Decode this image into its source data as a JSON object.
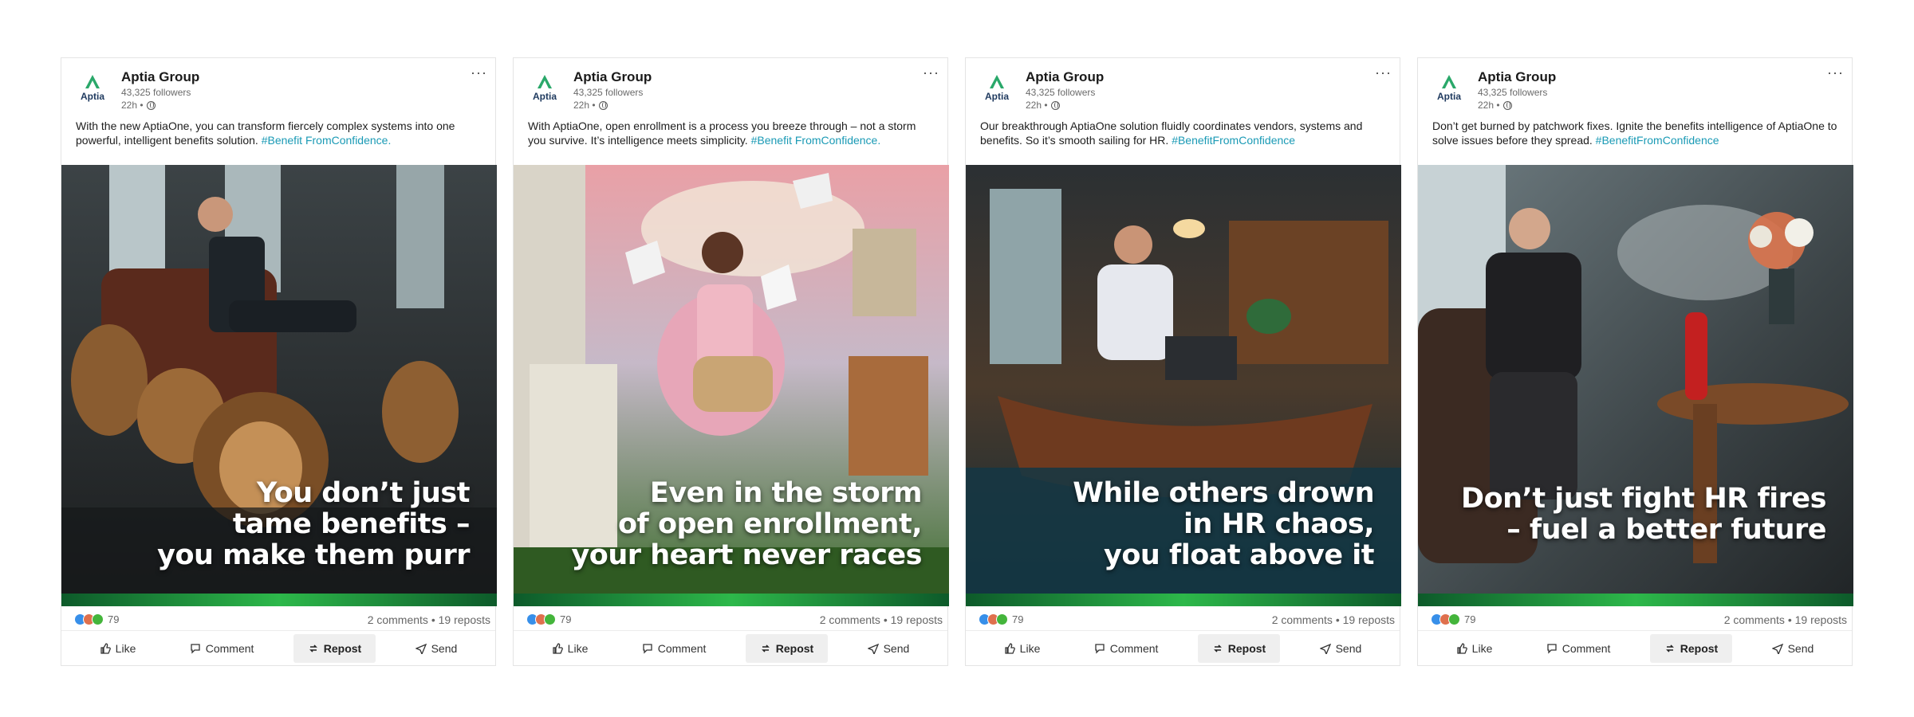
{
  "posts": [
    {
      "company": "Aptia Group",
      "logo_text": "Aptia",
      "followers": "43,325 followers",
      "time": "22h •",
      "body": "With the new AptiaOne, you can transform fiercely complex systems into one powerful, intelligent benefits solution.",
      "hashtag": "#Benefit FromConfidence.",
      "headline": [
        "You don’t just",
        "tame benefits –",
        "you make them purr"
      ],
      "reactions": "79",
      "counts": "2 comments • 19 reposts",
      "actions": [
        "Like",
        "Comment",
        "Repost",
        "Send"
      ]
    },
    {
      "company": "Aptia Group",
      "logo_text": "Aptia",
      "followers": "43,325 followers",
      "time": "22h •",
      "body": "With AptiaOne, open enrollment is a process you breeze through – not a storm you survive. It’s intelligence meets simplicity.",
      "hashtag": "#Benefit FromConfidence.",
      "headline": [
        "Even in the storm",
        "of open enrollment,",
        "your heart never races"
      ],
      "reactions": "79",
      "counts": "2 comments • 19 reposts",
      "actions": [
        "Like",
        "Comment",
        "Repost",
        "Send"
      ]
    },
    {
      "company": "Aptia Group",
      "logo_text": "Aptia",
      "followers": "43,325 followers",
      "time": "22h •",
      "body": "Our breakthrough AptiaOne solution fluidly coordinates vendors, systems and benefits. So it’s smooth sailing for HR.",
      "hashtag": "#BenefitFromConfidence",
      "headline": [
        "While others drown",
        "in HR chaos,",
        "you float above it"
      ],
      "reactions": "79",
      "counts": "2 comments • 19 reposts",
      "actions": [
        "Like",
        "Comment",
        "Repost",
        "Send"
      ]
    },
    {
      "company": "Aptia Group",
      "logo_text": "Aptia",
      "followers": "43,325 followers",
      "time": "22h •",
      "body": "Don’t get burned by patchwork fixes. Ignite the benefits intelligence of AptiaOne to solve issues before they spread.",
      "hashtag": "#BenefitFromConfidence",
      "headline": [
        "Don’t just fight HR fires",
        "– fuel a better future"
      ],
      "reactions": "79",
      "counts": "2 comments • 19 reposts",
      "actions": [
        "Like",
        "Comment",
        "Repost",
        "Send"
      ]
    }
  ],
  "colors": {
    "hashtag": "#1a9ab5",
    "logo_green": "#2aa86a",
    "logo_navy": "#1f3a5f",
    "accent_bar": "#2db84a"
  },
  "icons": [
    "like-icon",
    "comment-icon",
    "repost-icon",
    "send-icon",
    "globe-icon",
    "more-icon"
  ]
}
